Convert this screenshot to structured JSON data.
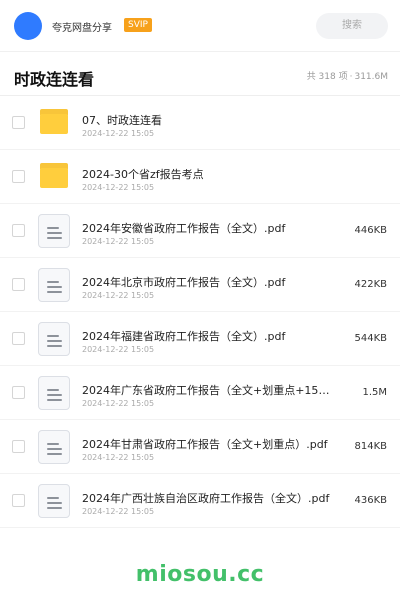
{
  "header": {
    "share_name": "夸克网盘分享",
    "badge": "SVIP",
    "search_placeholder": "搜索"
  },
  "folder": {
    "title": "时政连连看",
    "count": "共 318 项",
    "separator": "·",
    "total_size": "311.6M"
  },
  "files": [
    {
      "type": "folder",
      "name": "07、时政连连看",
      "date": "2024-12-22 15:05",
      "size": ""
    },
    {
      "type": "folder",
      "name": "2024-30个省zf报告考点",
      "date": "2024-12-22 15:05",
      "size": ""
    },
    {
      "type": "pdf",
      "name": "2024年安徽省政府工作报告（全文）.pdf",
      "date": "2024-12-22 15:05",
      "size": "446KB"
    },
    {
      "type": "pdf",
      "name": "2024年北京市政府工作报告（全文）.pdf",
      "date": "2024-12-22 15:05",
      "size": "422KB"
    },
    {
      "type": "pdf",
      "name": "2024年福建省政府工作报告（全文）.pdf",
      "date": "2024-12-22 15:05",
      "size": "544KB"
    },
    {
      "type": "pdf",
      "name": "2024年广东省政府工作报告（全文+划重点+150…",
      "date": "2024-12-22 15:05",
      "size": "1.5M"
    },
    {
      "type": "pdf",
      "name": "2024年甘肃省政府工作报告（全文+划重点）.pdf",
      "date": "2024-12-22 15:05",
      "size": "814KB"
    },
    {
      "type": "pdf",
      "name": "2024年广西壮族自治区政府工作报告（全文）.pdf",
      "date": "2024-12-22 15:05",
      "size": "436KB"
    }
  ],
  "watermark": "miosou.cc",
  "colors": {
    "avatar": "#2f7bff",
    "badge": "#f7a11b",
    "folder": "#ffce3d",
    "watermark": "#43c06a"
  }
}
